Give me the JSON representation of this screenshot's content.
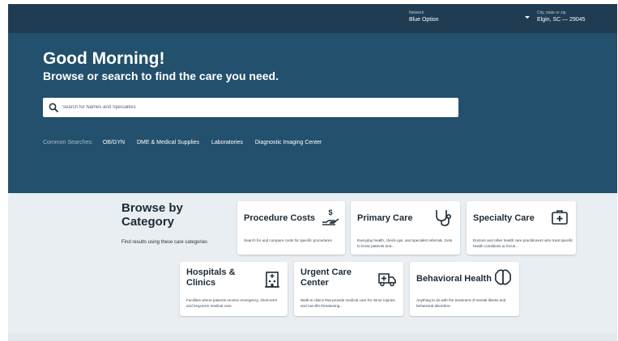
{
  "header": {
    "network": {
      "label": "Network",
      "value": "Blue Option"
    },
    "location": {
      "label": "City, state or zip",
      "value": "Elgin, SC — 29045"
    }
  },
  "hero": {
    "greeting": "Good Morning!",
    "subtitle": "Browse or search to find the care you need.",
    "search": {
      "placeholder": "Search for Names and Specialties"
    },
    "common_searches": {
      "label": "Common Searches:",
      "links": [
        "OB/GYN",
        "DME & Medical Supplies",
        "Laboratories",
        "Diagnostic Imaging Center"
      ]
    }
  },
  "browse": {
    "title": "Browse by Category",
    "subtitle": "Find results using these care categories",
    "cards": [
      {
        "title": "Procedure Costs",
        "desc": "Search for and compare costs for specific procedures",
        "icon": "hand-dollar-icon"
      },
      {
        "title": "Primary Care",
        "desc": "Everyday health, check-ups, and specialist referrals. Gets to know patients and...",
        "icon": "stethoscope-icon"
      },
      {
        "title": "Specialty Care",
        "desc": "Doctors and other health care practitioners who treat specific health conditions or focus...",
        "icon": "medical-kit-icon"
      },
      {
        "title": "Hospitals & Clinics",
        "desc": "Facilities where patients receive emergency, short-term and long-term medical care.",
        "icon": "hospital-building-icon"
      },
      {
        "title": "Urgent Care Center",
        "desc": "Walk-in clinics that provide medical care for minor injuries and non-life threatening...",
        "icon": "ambulance-icon"
      },
      {
        "title": "Behavioral Health",
        "desc": "Anything to do with the treatment of mental illness and behavioral disorders.",
        "icon": "brain-icon"
      }
    ]
  }
}
